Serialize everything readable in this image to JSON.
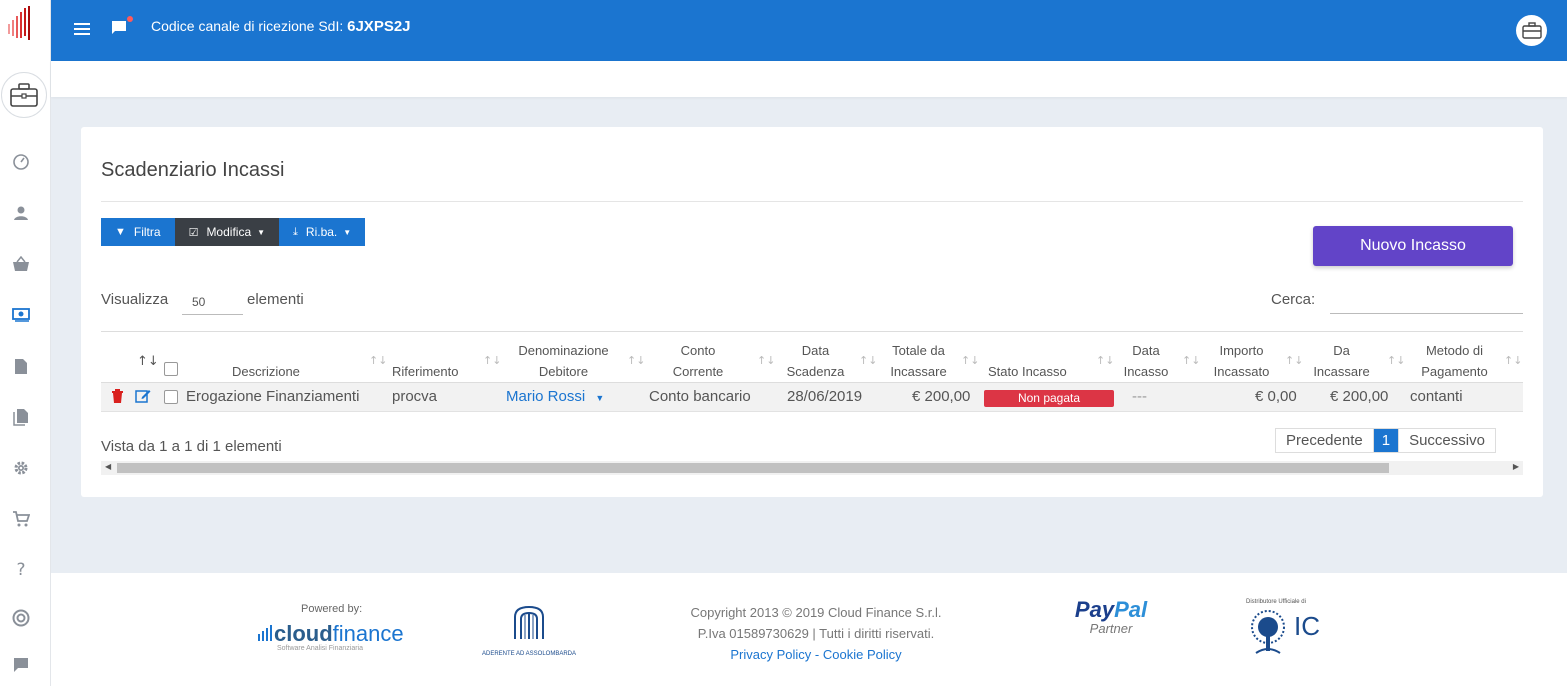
{
  "topbar": {
    "channel_label": "Codice canale di ricezione SdI:",
    "channel_code": "6JXPS2J",
    "accent_color": "#1b75d0"
  },
  "sidebar": {
    "items": [
      {
        "icon": "dashboard-icon"
      },
      {
        "icon": "user-icon"
      },
      {
        "icon": "basket-icon"
      },
      {
        "icon": "money-icon"
      },
      {
        "icon": "document-icon"
      },
      {
        "icon": "documents-icon"
      },
      {
        "icon": "gear-icon"
      },
      {
        "icon": "cart-icon"
      },
      {
        "icon": "help-icon"
      },
      {
        "icon": "lifebuoy-icon"
      },
      {
        "icon": "chat-icon"
      }
    ]
  },
  "page": {
    "title": "Scadenziario Incassi",
    "toolbar": {
      "filter_label": "Filtra",
      "edit_label": "Modifica",
      "riba_label": "Ri.ba."
    },
    "new_button_label": "Nuovo Incasso",
    "show_label": "Visualizza",
    "show_value": "50",
    "show_suffix": "elementi",
    "search_label": "Cerca:"
  },
  "table": {
    "headers": {
      "descrizione": "Descrizione",
      "riferimento": "Riferimento",
      "denominazione": [
        "Denominazione",
        "Debitore"
      ],
      "conto": [
        "Conto",
        "Corrente"
      ],
      "data_scadenza": [
        "Data",
        "Scadenza"
      ],
      "totale": [
        "Totale da",
        "Incassare"
      ],
      "stato": "Stato Incasso",
      "data_incasso": [
        "Data",
        "Incasso"
      ],
      "importo": [
        "Importo",
        "Incassato"
      ],
      "da_incassare": [
        "Da",
        "Incassare"
      ],
      "metodo": [
        "Metodo di",
        "Pagamento"
      ]
    },
    "rows": [
      {
        "descrizione": "Erogazione Finanziamenti",
        "riferimento": "procva",
        "debitore": "Mario Rossi",
        "conto": "Conto bancario",
        "data_scadenza": "28/06/2019",
        "totale": "€ 200,00",
        "stato": "Non pagata",
        "data_incasso": "---",
        "importo": "€ 0,00",
        "da_incassare": "€ 200,00",
        "metodo": "contanti"
      }
    ],
    "info": "Vista da 1 a 1 di 1 elementi",
    "pager": {
      "prev": "Precedente",
      "current": "1",
      "next": "Successivo"
    }
  },
  "footer": {
    "powered_by": "Powered by:",
    "cf_brand_a": "cloud",
    "cf_brand_b": "finance",
    "cf_sub": "Software Analisi Finanziaria",
    "asso_text": "ADERENTE AD ASSOLOMBARDA",
    "copyright_line1": "Copyright 2013 © 2019 Cloud Finance S.r.l.",
    "copyright_line2": "P.Iva 01589730629 | Tutti i diritti riservati.",
    "privacy": "Privacy Policy",
    "separator": " - ",
    "cookie": "Cookie Policy",
    "paypal_a": "Pay",
    "paypal_b": "Pal",
    "paypal_partner": "Partner",
    "ic_top": "Distributore Ufficiale di",
    "ic_text": "IC"
  }
}
